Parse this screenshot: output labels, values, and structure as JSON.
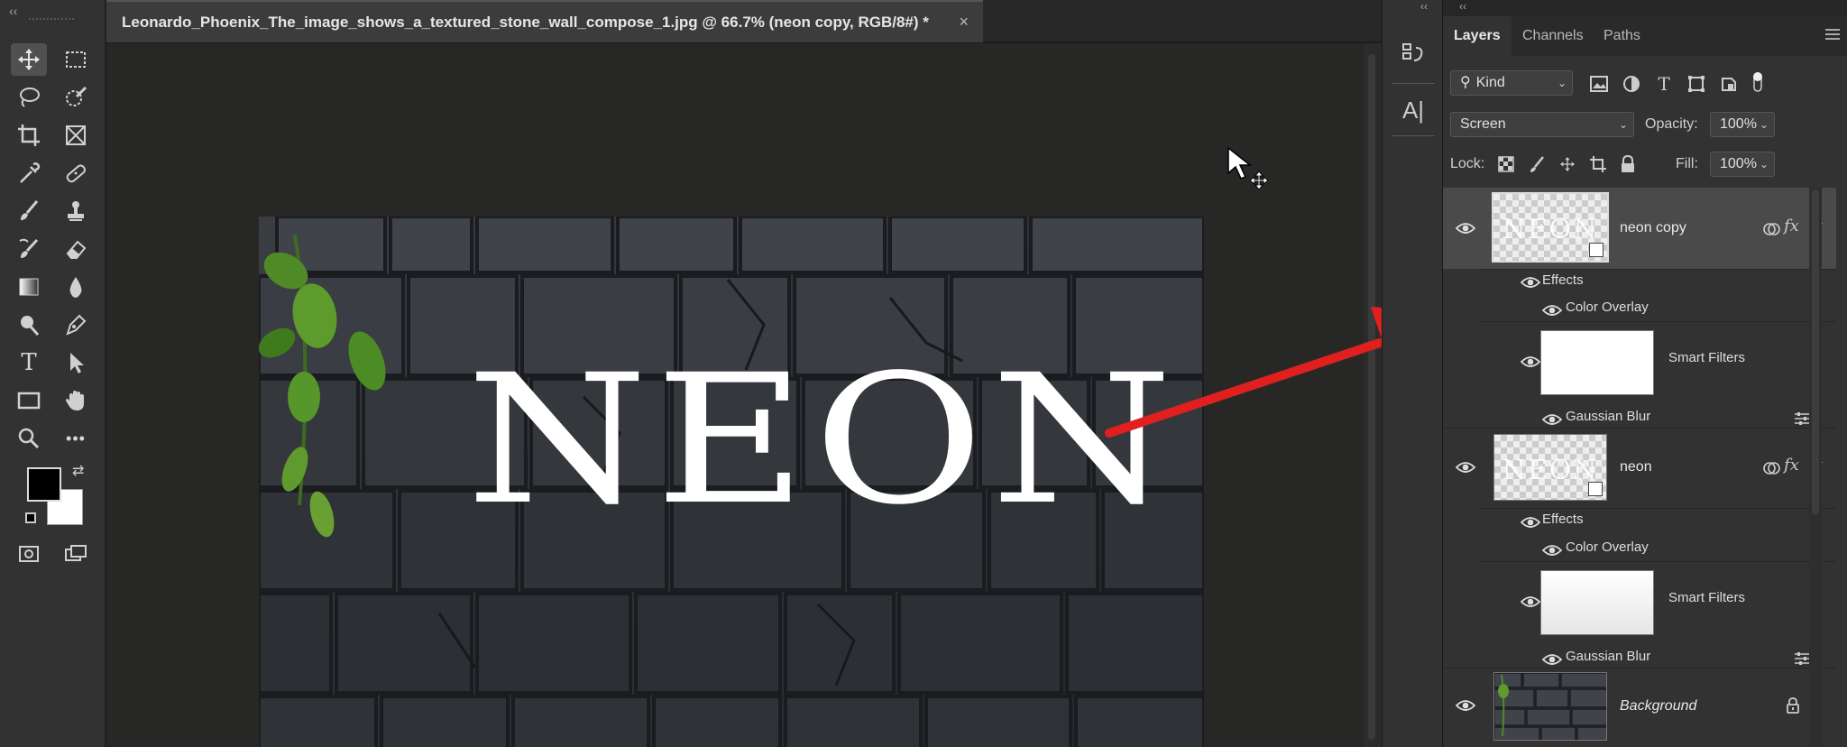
{
  "document": {
    "tab_title": "Leonardo_Phoenix_The_image_shows_a_textured_stone_wall_compose_1.jpg @ 66.7% (neon copy, RGB/8#) *",
    "close_label": "×"
  },
  "canvas": {
    "headline_text": "NEON"
  },
  "toolbar": {
    "collapse_label": "‹‹",
    "tools": [
      "move-tool",
      "marquee-tool",
      "lasso-tool",
      "quick-selection-tool",
      "crop-tool",
      "frame-tool",
      "eyedropper-tool",
      "healing-brush-tool",
      "brush-tool",
      "clone-stamp-tool",
      "history-brush-tool",
      "eraser-tool",
      "gradient-tool",
      "blur-tool",
      "dodge-tool",
      "pen-tool",
      "type-tool",
      "path-selection-tool",
      "rectangle-tool",
      "hand-tool",
      "zoom-tool",
      "more-tools"
    ],
    "type_tool_glyph": "T",
    "more_glyph": "•••",
    "swap_glyph": "⇄",
    "foreground_color": "#000000",
    "background_color": "#ffffff"
  },
  "mid_strip": {
    "collapse_label": "‹‹",
    "character_glyph": "A|"
  },
  "panel": {
    "collapse_label": "‹‹",
    "tabs": [
      {
        "label": "Layers",
        "active": true
      },
      {
        "label": "Channels",
        "active": false
      },
      {
        "label": "Paths",
        "active": false
      }
    ],
    "filter_kind": "Kind",
    "filter_type_glyph": "T",
    "blend_mode": "Screen",
    "opacity_label": "Opacity:",
    "opacity_value": "100%",
    "lock_label": "Lock:",
    "fill_label": "Fill:",
    "fill_value": "100%",
    "layers": [
      {
        "name": "neon copy",
        "selected": true,
        "effects_label": "Effects",
        "effect": "Color Overlay",
        "smart_filters_label": "Smart Filters",
        "filter": "Gaussian Blur",
        "thumb_text": "NEON"
      },
      {
        "name": "neon",
        "selected": false,
        "effects_label": "Effects",
        "effect": "Color Overlay",
        "smart_filters_label": "Smart Filters",
        "filter": "Gaussian Blur",
        "thumb_text": "NEON"
      },
      {
        "name": "Background",
        "selected": false,
        "locked": true
      }
    ],
    "fx_label": "fx"
  },
  "colors": {
    "arrow_red": "#e0201f",
    "panel_bg": "#323232",
    "selected_row": "#4a4a4a"
  }
}
